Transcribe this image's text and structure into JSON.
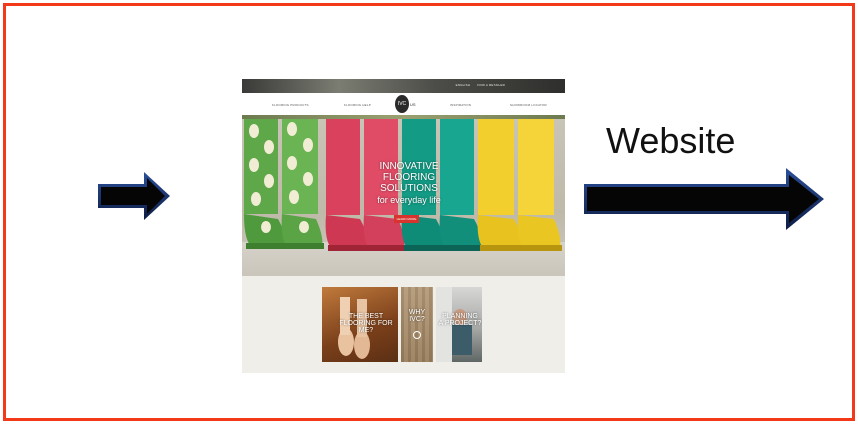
{
  "colors": {
    "frame": "#f2391a",
    "arrow_fill": "#0b0b0b",
    "arrow_edge": "#1f3d7a",
    "accent_red": "#d8332c"
  },
  "caption": "Website",
  "thumbnail": {
    "topbar_links": [
      "ENGLISH",
      "FIND A RETAILER"
    ],
    "nav": {
      "items": [
        "FLOORING PRODUCTS",
        "FLOORING HELP",
        "INSPIRATION",
        "SHOWROOM LOCATOR"
      ],
      "logo": "IVC",
      "logo_suffix": "US"
    },
    "hero": {
      "line1": "INNOVATIVE",
      "line2": "FLOORING SOLUTIONS",
      "line3": "for everyday life",
      "button": "LEARN MORE"
    },
    "tiles": [
      {
        "text_line1": "THE BEST",
        "text_line2": "FLOORING FOR ME?"
      },
      {
        "text_line1": "WHY",
        "text_line2": "IVC?"
      },
      {
        "text_line1": "PLANNING",
        "text_line2": "A PROJECT?"
      }
    ]
  }
}
